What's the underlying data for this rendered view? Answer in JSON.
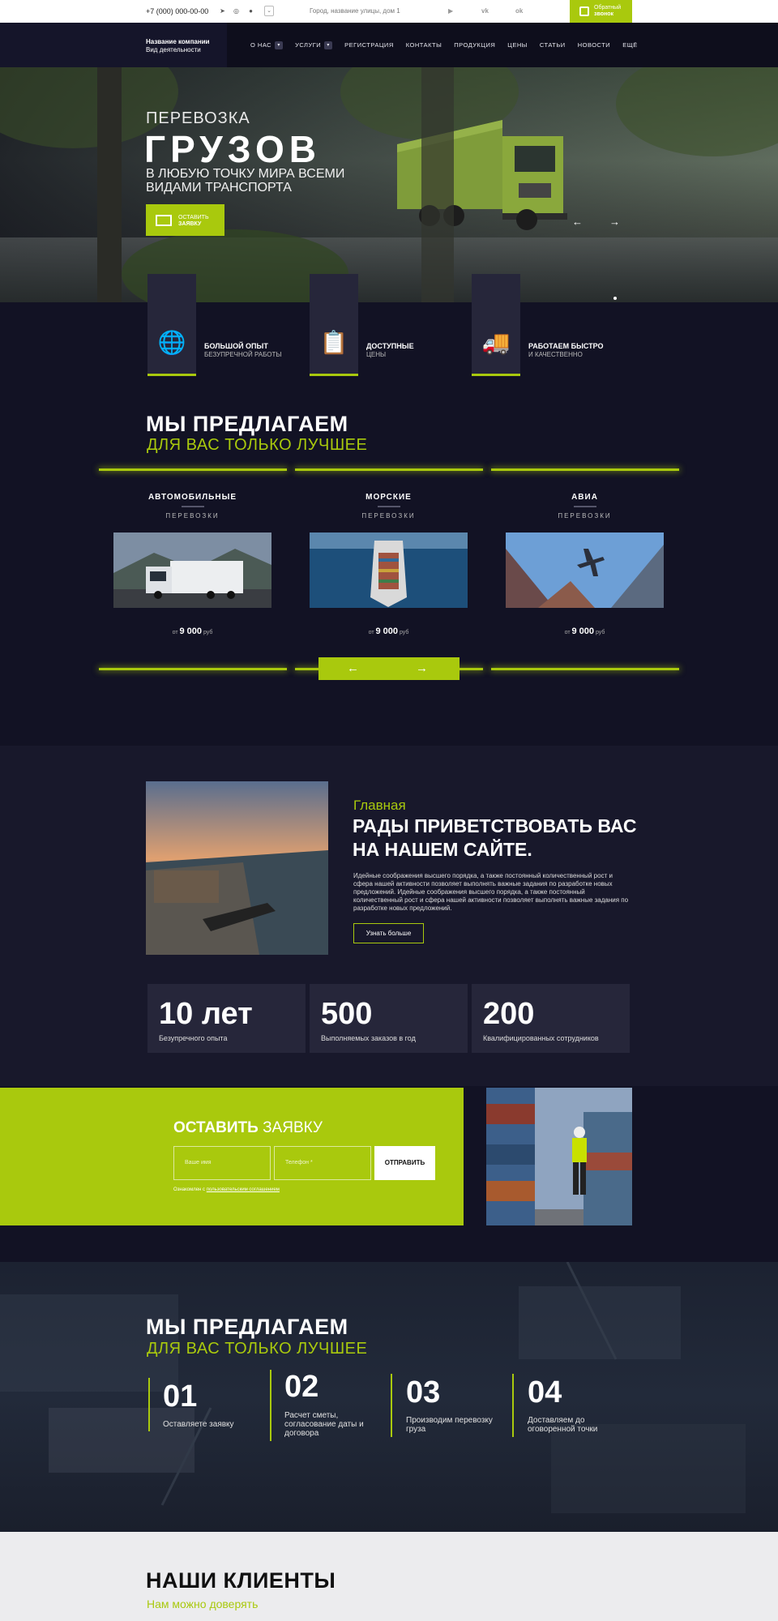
{
  "topbar": {
    "phone": "+7 (000) 000-00-00",
    "address": "Город, название улицы, дом 1",
    "callback_line1": "Обратный",
    "callback_line2": "звонок"
  },
  "nav": {
    "company_name": "Название компании",
    "company_activity": "Вид деятельности",
    "items": [
      "О НАС",
      "УСЛУГИ",
      "РЕГИСТРАЦИЯ",
      "КОНТАКТЫ",
      "ПРОДУКЦИЯ",
      "ЦЕНЫ",
      "СТАТЬИ",
      "НОВОСТИ",
      "ЕЩЁ"
    ]
  },
  "hero": {
    "line1": "ПЕРЕВОЗКА",
    "line2": "ГРУЗОВ",
    "line3": "В ЛЮБУЮ ТОЧКУ МИРА ВСЕМИ ВИДАМИ ТРАНСПОРТА",
    "cta_line1": "ОСТАВИТЬ",
    "cta_line2": "ЗАЯВКУ"
  },
  "features": [
    {
      "title": "БОЛЬШОЙ ОПЫТ",
      "subtitle": "БЕЗУПРЕЧНОЙ РАБОТЫ",
      "icon": "globe-pin-icon"
    },
    {
      "title": "ДОСТУПНЫЕ",
      "subtitle": "ЦЕНЫ",
      "icon": "checklist-box-icon"
    },
    {
      "title": "РАБОТАЕМ БЫСТРО",
      "subtitle": "И КАЧЕСТВЕННО",
      "icon": "delivery-truck-icon"
    }
  ],
  "offers": {
    "title": "МЫ ПРЕДЛАГАЕМ",
    "subtitle": "ДЛЯ ВАС ТОЛЬКО ЛУЧШЕЕ",
    "cards": [
      {
        "title": "АВТОМОБИЛЬНЫЕ",
        "subtitle": "ПЕРЕВОЗКИ",
        "price_prefix": "от",
        "price": "9 000",
        "price_unit": "руб"
      },
      {
        "title": "МОРСКИЕ",
        "subtitle": "ПЕРЕВОЗКИ",
        "price_prefix": "от",
        "price": "9 000",
        "price_unit": "руб"
      },
      {
        "title": "АВИА",
        "subtitle": "ПЕРЕВОЗКИ",
        "price_prefix": "от",
        "price": "9 000",
        "price_unit": "руб"
      }
    ]
  },
  "welcome": {
    "kicker": "Главная",
    "title": "РАДЫ ПРИВЕТСТВОВАТЬ ВАС НА НАШЕМ САЙТЕ.",
    "text": "Идейные соображения высшего порядка, а также постоянный количественный рост и сфера нашей активности позволяет выполнять важные задания по разработке новых предложений. Идейные соображения высшего порядка, а также постоянный количественный рост и сфера нашей активности позволяет выполнять важные задания по разработке новых предложений.",
    "button": "Узнать больше"
  },
  "stats": [
    {
      "value": "10 лет",
      "label": "Безупречного опыта"
    },
    {
      "value": "500",
      "label": "Выполняемых заказов в год"
    },
    {
      "value": "200",
      "label": "Квалифицированных сотрудников"
    }
  ],
  "form": {
    "title_bold": "ОСТАВИТЬ",
    "title_light": "ЗАЯВКУ",
    "name_placeholder": "Ваше имя",
    "phone_placeholder": "Телефон *",
    "submit": "ОТПРАВИТЬ",
    "agree_prefix": "Ознакомлен с",
    "agree_link": "пользовательским соглашением"
  },
  "steps": {
    "title": "МЫ ПРЕДЛАГАЕМ",
    "subtitle": "ДЛЯ ВАС ТОЛЬКО ЛУЧШЕЕ",
    "items": [
      {
        "num": "01",
        "text": "Оставляете заявку"
      },
      {
        "num": "02",
        "text": "Расчет сметы, согласование даты и договора"
      },
      {
        "num": "03",
        "text": "Производим перевозку груза"
      },
      {
        "num": "04",
        "text": "Доставляем до оговоренной точки"
      }
    ]
  },
  "clients": {
    "title": "НАШИ КЛИЕНТЫ",
    "subtitle": "Нам можно доверять"
  },
  "colors": {
    "accent": "#a9c90d",
    "dark": "#121224",
    "panel": "#26263a"
  }
}
